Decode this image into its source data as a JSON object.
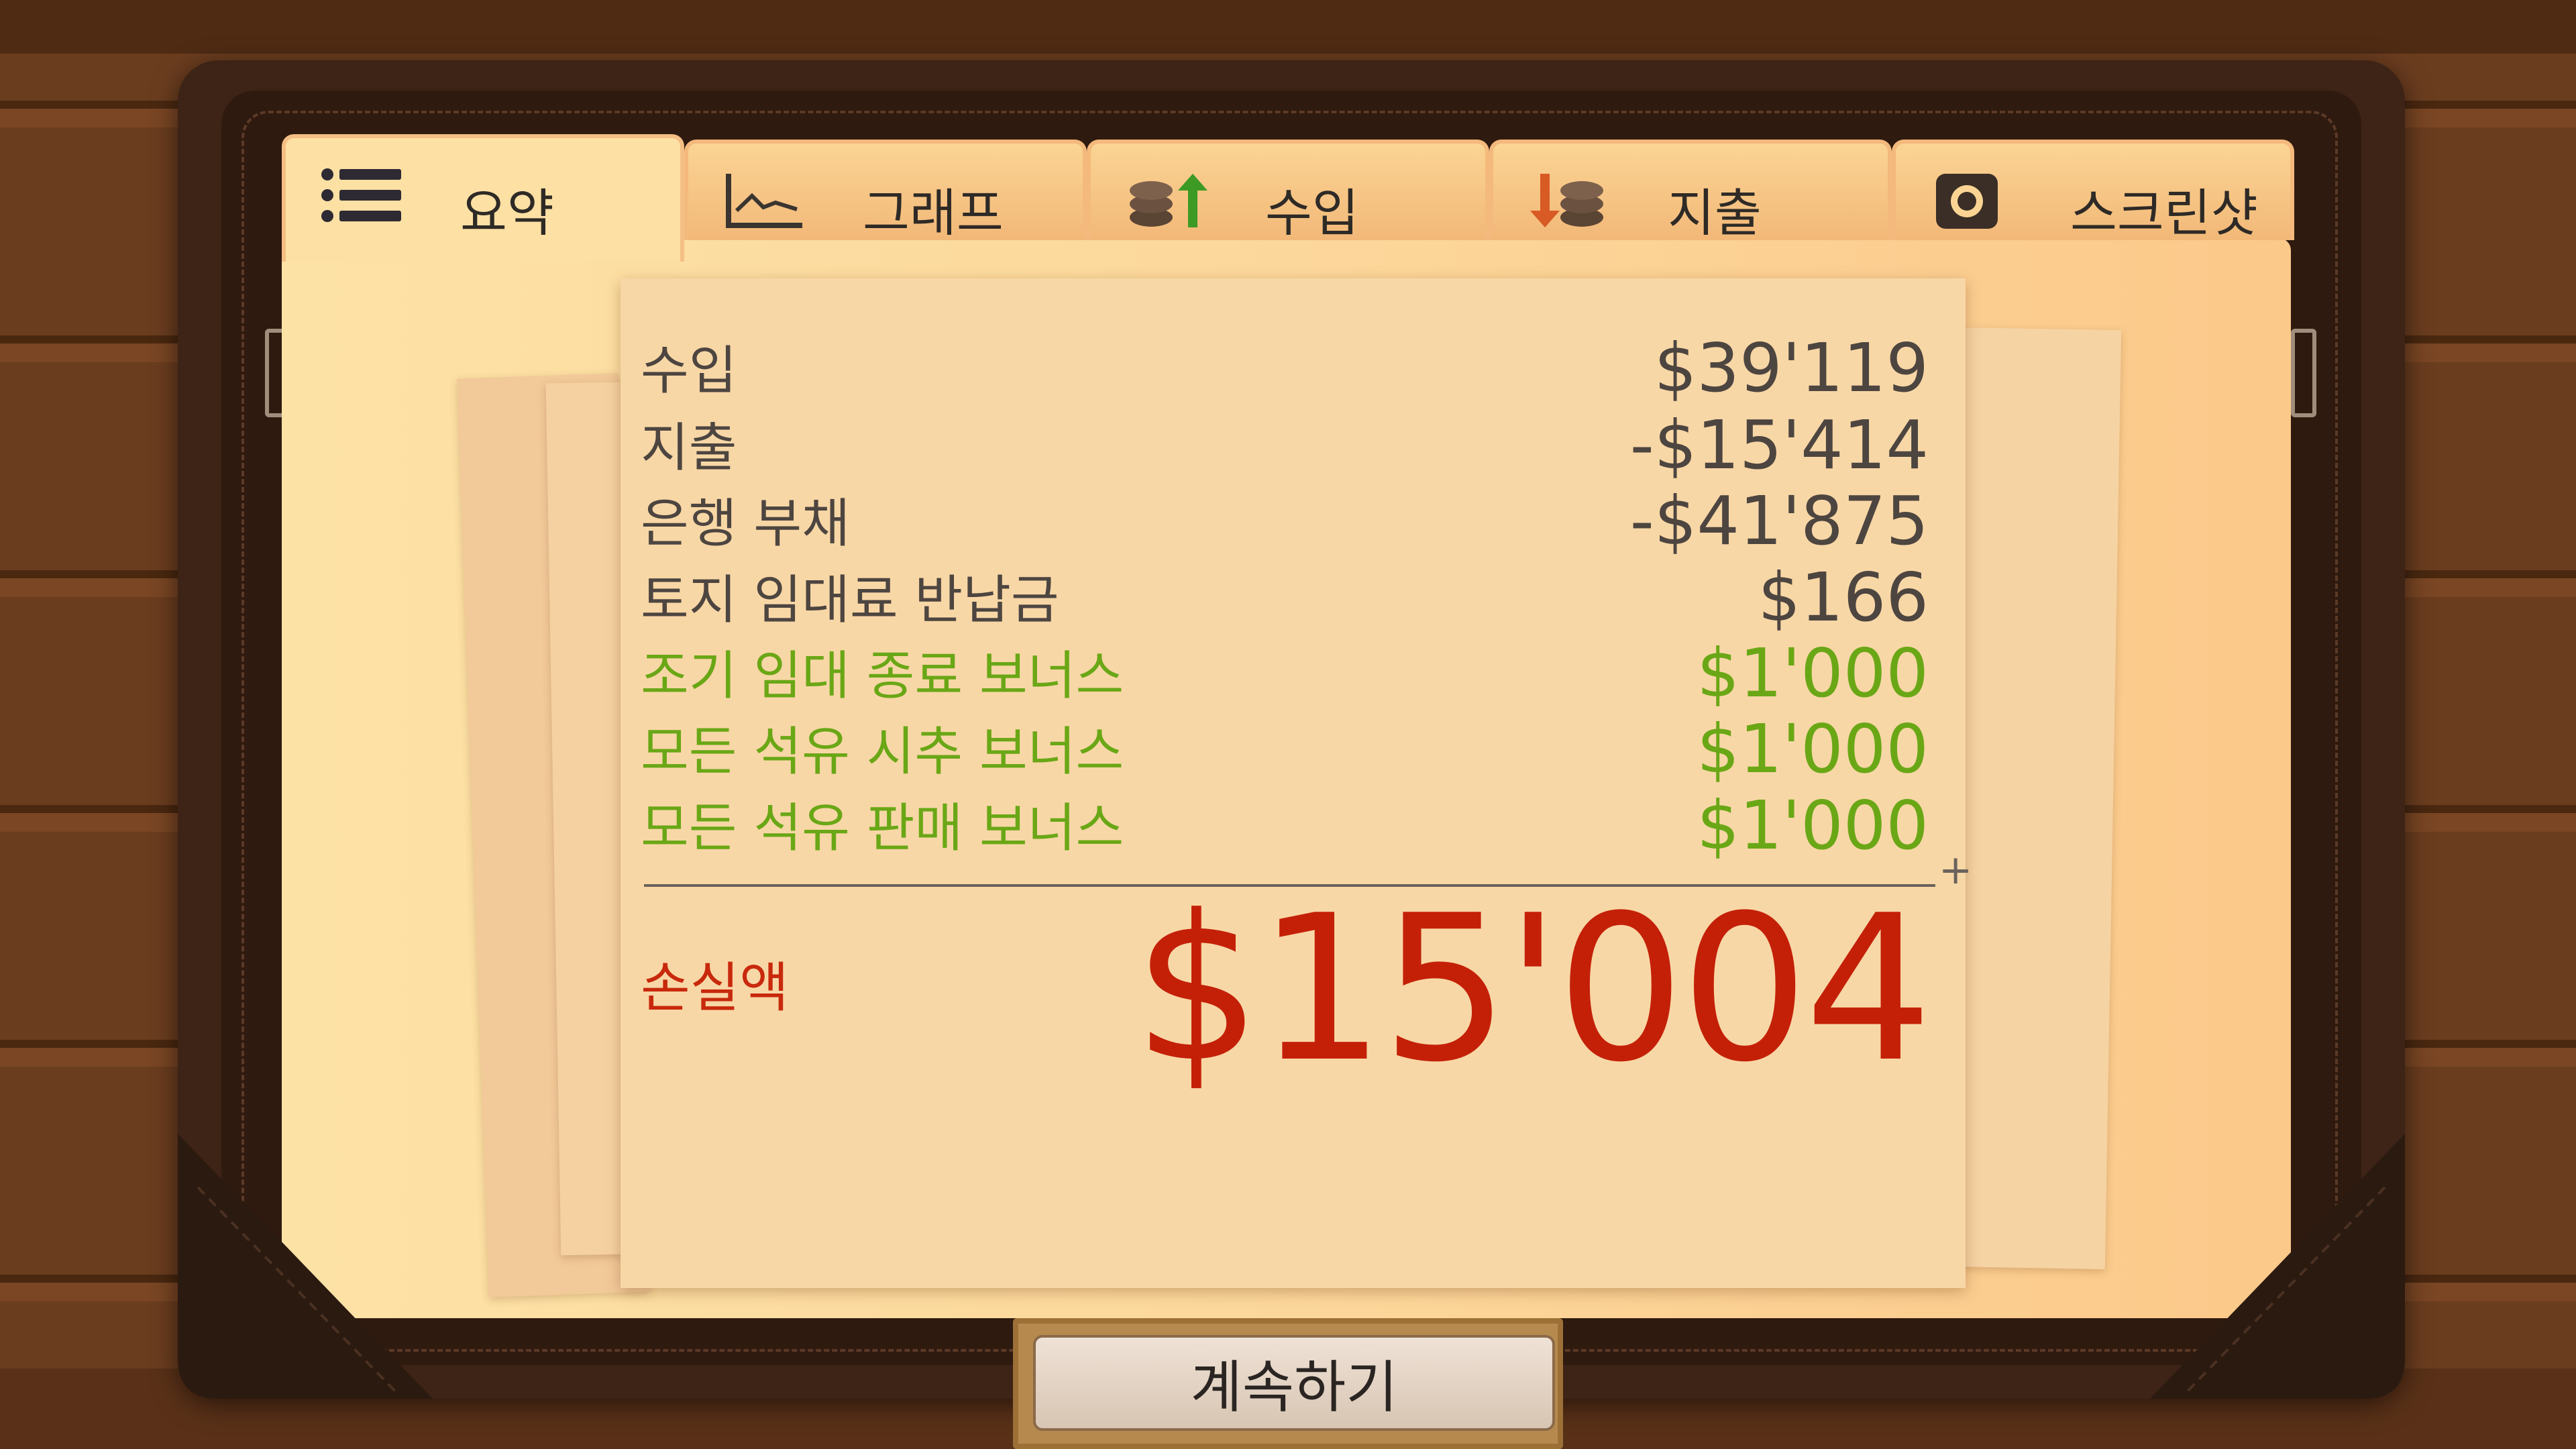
{
  "tabs": [
    {
      "label": "요약",
      "icon": "list-icon",
      "active": true
    },
    {
      "label": "그래프",
      "icon": "line-graph-icon",
      "active": false
    },
    {
      "label": "수입",
      "icon": "coins-up-icon",
      "active": false
    },
    {
      "label": "지출",
      "icon": "coins-down-icon",
      "active": false
    },
    {
      "label": "스크린샷",
      "icon": "camera-icon",
      "active": false
    }
  ],
  "summary": {
    "rows": [
      {
        "label": "수입",
        "value": "$39'119"
      },
      {
        "label": "지출",
        "value": "-$15'414"
      },
      {
        "label": "은행 부채",
        "value": "-$41'875"
      },
      {
        "label": "토지 임대료 반납금",
        "value": "$166"
      },
      {
        "label": "조기 임대 종료 보너스",
        "value": "$1'000"
      },
      {
        "label": "모든 석유 시추 보너스",
        "value": "$1'000"
      },
      {
        "label": "모든 석유 판매 보너스",
        "value": "$1'000"
      }
    ],
    "sum_symbol": "+",
    "result_label": "손실액",
    "result_value": "$15'004"
  },
  "colors": {
    "text": "#4d4540",
    "bonus": "#6aa716",
    "loss": "#c42008"
  },
  "continue_label": "계속하기"
}
